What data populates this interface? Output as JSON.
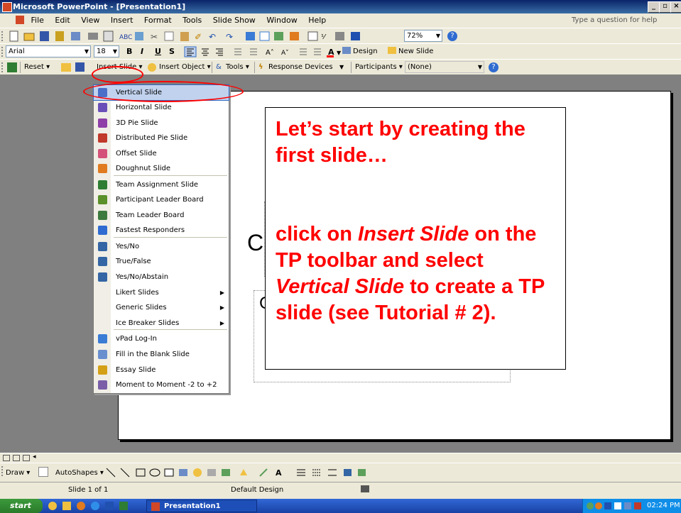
{
  "window": {
    "title": "Microsoft PowerPoint - [Presentation1]"
  },
  "menubar": {
    "items": [
      "File",
      "Edit",
      "View",
      "Insert",
      "Format",
      "Tools",
      "Slide Show",
      "Window",
      "Help"
    ],
    "help_placeholder": "Type a question for help"
  },
  "formatting": {
    "font": "Arial",
    "size": "18",
    "bold": "B",
    "italic": "I",
    "underline": "U",
    "shadow": "S",
    "design_label": "Design",
    "new_slide_label": "New Slide"
  },
  "standard": {
    "zoom": "72%"
  },
  "tp_toolbar": {
    "reset_label": "Reset",
    "insert_slide_label": "Insert Slide",
    "insert_object_label": "Insert Object",
    "tools_label": "Tools",
    "response_devices_label": "Response Devices",
    "participants_label": "Participants",
    "participants_value": "(None)"
  },
  "dropdown": {
    "items": [
      {
        "label": "Vertical Slide",
        "icon": "vertical-bar-chart-icon",
        "color": "#4a6fc9"
      },
      {
        "label": "Horizontal Slide",
        "icon": "horizontal-bar-chart-icon",
        "color": "#6b4fb8"
      },
      {
        "label": "3D Pie Slide",
        "icon": "pie-3d-icon",
        "color": "#8e3fa8"
      },
      {
        "label": "Distributed Pie Slide",
        "icon": "distributed-pie-icon",
        "color": "#c0392b"
      },
      {
        "label": "Offset Slide",
        "icon": "offset-chart-icon",
        "color": "#d4527a"
      },
      {
        "label": "Doughnut Slide",
        "icon": "doughnut-chart-icon",
        "color": "#e07b20"
      },
      {
        "label": "Team Assignment Slide",
        "icon": "team-assignment-icon",
        "color": "#2f7d32"
      },
      {
        "label": "Participant Leader Board",
        "icon": "participant-leader-icon",
        "color": "#5a8f29"
      },
      {
        "label": "Team Leader Board",
        "icon": "team-leader-icon",
        "color": "#3d7a3d"
      },
      {
        "label": "Fastest Responders",
        "icon": "clock-icon",
        "color": "#2f6bd0"
      },
      {
        "label": "Yes/No",
        "icon": "list-icon",
        "color": "#3465a4"
      },
      {
        "label": "True/False",
        "icon": "list-icon",
        "color": "#3465a4"
      },
      {
        "label": "Yes/No/Abstain",
        "icon": "list-icon",
        "color": "#3465a4"
      },
      {
        "label": "Likert Slides",
        "icon": "",
        "color": ""
      },
      {
        "label": "Generic Slides",
        "icon": "",
        "color": ""
      },
      {
        "label": "Ice Breaker Slides",
        "icon": "",
        "color": ""
      },
      {
        "label": "vPad Log-In",
        "icon": "vpad-icon",
        "color": "#3a7bd5"
      },
      {
        "label": "Fill in the Blank Slide",
        "icon": "pencil-icon",
        "color": "#6a8fcf"
      },
      {
        "label": "Essay Slide",
        "icon": "essay-icon",
        "color": "#d4a017"
      },
      {
        "label": "Moment to Moment -2 to +2",
        "icon": "line-chart-icon",
        "color": "#7b5ea7"
      }
    ]
  },
  "callout": {
    "para1": "Let’s start by creating the first slide…",
    "line_a": "click on ",
    "em_a": "Insert Slide",
    "line_b": " on the TP toolbar and select ",
    "em_b": "Vertical Slide",
    "line_c": " to create a TP slide (see Tutorial # 2)."
  },
  "slide": {
    "placeholder_char": "C"
  },
  "drawing": {
    "draw_label": "Draw",
    "autoshapes_label": "AutoShapes"
  },
  "status": {
    "slide_info": "Slide 1 of 1",
    "design": "Default Design"
  },
  "taskbar": {
    "start_label": "start",
    "task_label": "Presentation1",
    "clock": "02:24 PM"
  },
  "colors": {
    "accent_red": "#ff0000",
    "selection": "#c1d2ee"
  }
}
